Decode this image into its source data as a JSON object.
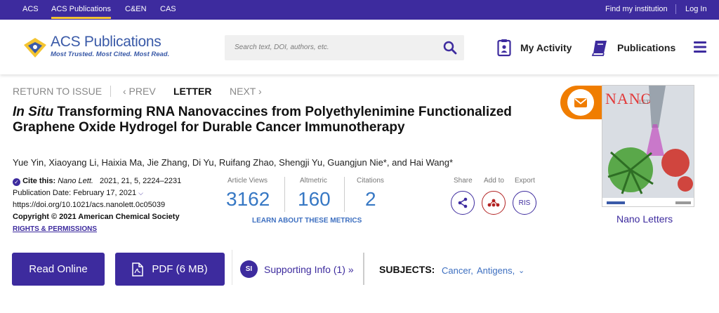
{
  "topnav": {
    "items": [
      "ACS",
      "ACS Publications",
      "C&EN",
      "CAS"
    ],
    "right": [
      "Find my institution",
      "Log In"
    ]
  },
  "header": {
    "logo_title": "ACS Publications",
    "logo_tagline": "Most Trusted. Most Cited. Most Read.",
    "search_placeholder": "Search text, DOI, authors, etc.",
    "my_activity": "My Activity",
    "publications": "Publications"
  },
  "issue_nav": {
    "return": "RETURN TO ISSUE",
    "prev": "‹ PREV",
    "current": "LETTER",
    "next": "NEXT ›"
  },
  "article": {
    "title_italic": "In Situ",
    "title_rest": " Transforming RNA Nanovaccines from Polyethylenimine Functionalized Graphene Oxide Hydrogel for Durable Cancer Immunotherapy",
    "authors": "Yue Yin, Xiaoyang Li, Haixia Ma, Jie Zhang, Di Yu, Ruifang Zhao, Shengji Yu, Guangjun Nie*, and Hai Wang*",
    "cite_label": "Cite this:",
    "cite_journal": "Nano Lett.",
    "cite_ref": "2021, 21, 5, 2224–2231",
    "pub_date": "Publication Date: February 17, 2021",
    "doi": "https://doi.org/10.1021/acs.nanolett.0c05039",
    "copyright": "Copyright © 2021 American Chemical Society",
    "rights": "RIGHTS & PERMISSIONS"
  },
  "metrics": {
    "views_label": "Article Views",
    "views": "3162",
    "altmetric_label": "Altmetric",
    "altmetric": "160",
    "citations_label": "Citations",
    "citations": "2",
    "learn": "LEARN ABOUT THESE METRICS"
  },
  "actions": {
    "share": "Share",
    "add_to": "Add to",
    "export": "Export",
    "ris": "RIS"
  },
  "cover": {
    "caption": "Nano Letters"
  },
  "buttons": {
    "read_online": "Read Online",
    "pdf": "PDF (6 MB)",
    "si_badge": "SI",
    "supporting_info": "Supporting Info (1) »",
    "subjects_label": "SUBJECTS:",
    "subject_1": "Cancer,",
    "subject_2": "Antigens,"
  },
  "colors": {
    "brand_purple": "#3d2b9e",
    "accent_orange": "#f07d00",
    "metric_blue": "#3778c4"
  }
}
